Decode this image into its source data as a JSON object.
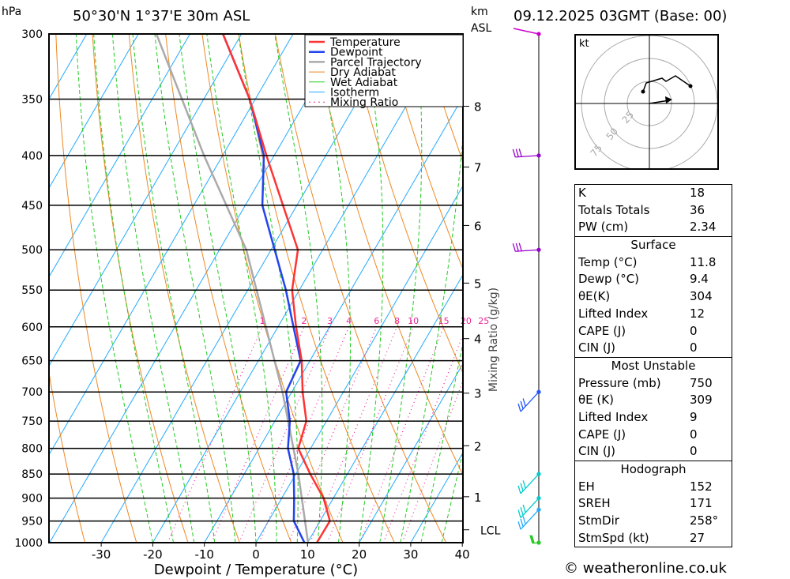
{
  "header": {
    "location": "50°30'N 1°37'E 30m ASL",
    "datetime": "09.12.2025 03GMT (Base: 00)",
    "hpa_label": "hPa",
    "km_label": "km",
    "asl_label": "ASL"
  },
  "chart_data": {
    "type": "skew-t",
    "xlabel": "Dewpoint / Temperature (°C)",
    "x_ticks": [
      -30,
      -20,
      -10,
      0,
      10,
      20,
      30,
      40
    ],
    "xlim": [
      -40,
      40
    ],
    "pressure_ticks": [
      300,
      350,
      400,
      450,
      500,
      550,
      600,
      650,
      700,
      750,
      800,
      850,
      900,
      950,
      1000
    ],
    "ylim_hpa": [
      1000,
      300
    ],
    "height_km_ticks": [
      {
        "km": "1",
        "p": 897
      },
      {
        "km": "2",
        "p": 795
      },
      {
        "km": "3",
        "p": 702
      },
      {
        "km": "4",
        "p": 617
      },
      {
        "km": "5",
        "p": 541
      },
      {
        "km": "6",
        "p": 472
      },
      {
        "km": "7",
        "p": 411
      },
      {
        "km": "8",
        "p": 356
      }
    ],
    "lcl": {
      "label": "LCL",
      "p": 970
    },
    "mixing_ratio_label": "Mixing Ratio (g/kg)",
    "mixing_ratios": [
      1,
      2,
      3,
      4,
      6,
      8,
      10,
      15,
      20,
      25
    ],
    "legend": [
      "Temperature",
      "Dewpoint",
      "Parcel Trajectory",
      "Dry Adiabat",
      "Wet Adiabat",
      "Isotherm",
      "Mixing Ratio"
    ],
    "legend_placement": "top-center",
    "colors": {
      "temperature": "#ff3333",
      "dewpoint": "#2244ee",
      "parcel": "#aaaaaa",
      "dry_adiabat": "#ee8822",
      "wet_adiabat": "#22cc22",
      "isotherm": "#22aaff",
      "mixing_ratio": "#ee2299"
    },
    "temperature": {
      "p": [
        1000,
        950,
        900,
        850,
        800,
        750,
        700,
        650,
        600,
        550,
        500,
        450,
        400,
        350,
        300
      ],
      "t": [
        11.8,
        11.9,
        8.1,
        2.8,
        -2.4,
        -3.9,
        -7.9,
        -11.6,
        -16.5,
        -21.4,
        -24.8,
        -32.7,
        -41.5,
        -51.1,
        -63.6
      ]
    },
    "dewpoint": {
      "p": [
        1000,
        950,
        900,
        850,
        800,
        750,
        700,
        650,
        600,
        550,
        500,
        450,
        400,
        350,
        300
      ],
      "t": [
        9.4,
        4.9,
        2.4,
        -0.4,
        -4.4,
        -7.1,
        -11.1,
        -11.8,
        -17.0,
        -22.6,
        -29.3,
        -36.7,
        -42.0,
        -51.1,
        -63.6
      ]
    },
    "parcel": {
      "p": [
        1000,
        850,
        700,
        500,
        400,
        300
      ],
      "t": [
        10.1,
        0.5,
        -11.8,
        -34.8,
        -53.6,
        -76.5
      ]
    },
    "wind_barbs": [
      {
        "p": 300,
        "color": "#cc00cc"
      },
      {
        "p": 400,
        "color": "#9900cc"
      },
      {
        "p": 500,
        "color": "#9900cc"
      },
      {
        "p": 700,
        "color": "#2255ff"
      },
      {
        "p": 850,
        "color": "#00cccc"
      },
      {
        "p": 900,
        "color": "#00cccc"
      },
      {
        "p": 925,
        "color": "#22aaff"
      },
      {
        "p": 1000,
        "color": "#22cc22"
      }
    ]
  },
  "hodograph": {
    "unit": "kt",
    "rings": [
      "25",
      "50",
      "75"
    ]
  },
  "indices": {
    "top": [
      {
        "k": "K",
        "v": "18"
      },
      {
        "k": "Totals Totals",
        "v": "36"
      },
      {
        "k": "PW (cm)",
        "v": "2.34"
      }
    ],
    "surface_title": "Surface",
    "surface": [
      {
        "k": "Temp (°C)",
        "v": "11.8"
      },
      {
        "k": "Dewp (°C)",
        "v": "9.4"
      },
      {
        "k": "θE(K)",
        "v": "304"
      },
      {
        "k": "Lifted Index",
        "v": "12"
      },
      {
        "k": "CAPE (J)",
        "v": "0"
      },
      {
        "k": "CIN (J)",
        "v": "0"
      }
    ],
    "mu_title": "Most Unstable",
    "mu": [
      {
        "k": "Pressure (mb)",
        "v": "750"
      },
      {
        "k": "θE (K)",
        "v": "309"
      },
      {
        "k": "Lifted Index",
        "v": "9"
      },
      {
        "k": "CAPE (J)",
        "v": "0"
      },
      {
        "k": "CIN (J)",
        "v": "0"
      }
    ],
    "hodo_title": "Hodograph",
    "hodo": [
      {
        "k": "EH",
        "v": "152"
      },
      {
        "k": "SREH",
        "v": "171"
      },
      {
        "k": "StmDir",
        "v": "258°"
      },
      {
        "k": "StmSpd (kt)",
        "v": "27"
      }
    ]
  },
  "footer": {
    "copyright": "© weatheronline.co.uk"
  }
}
